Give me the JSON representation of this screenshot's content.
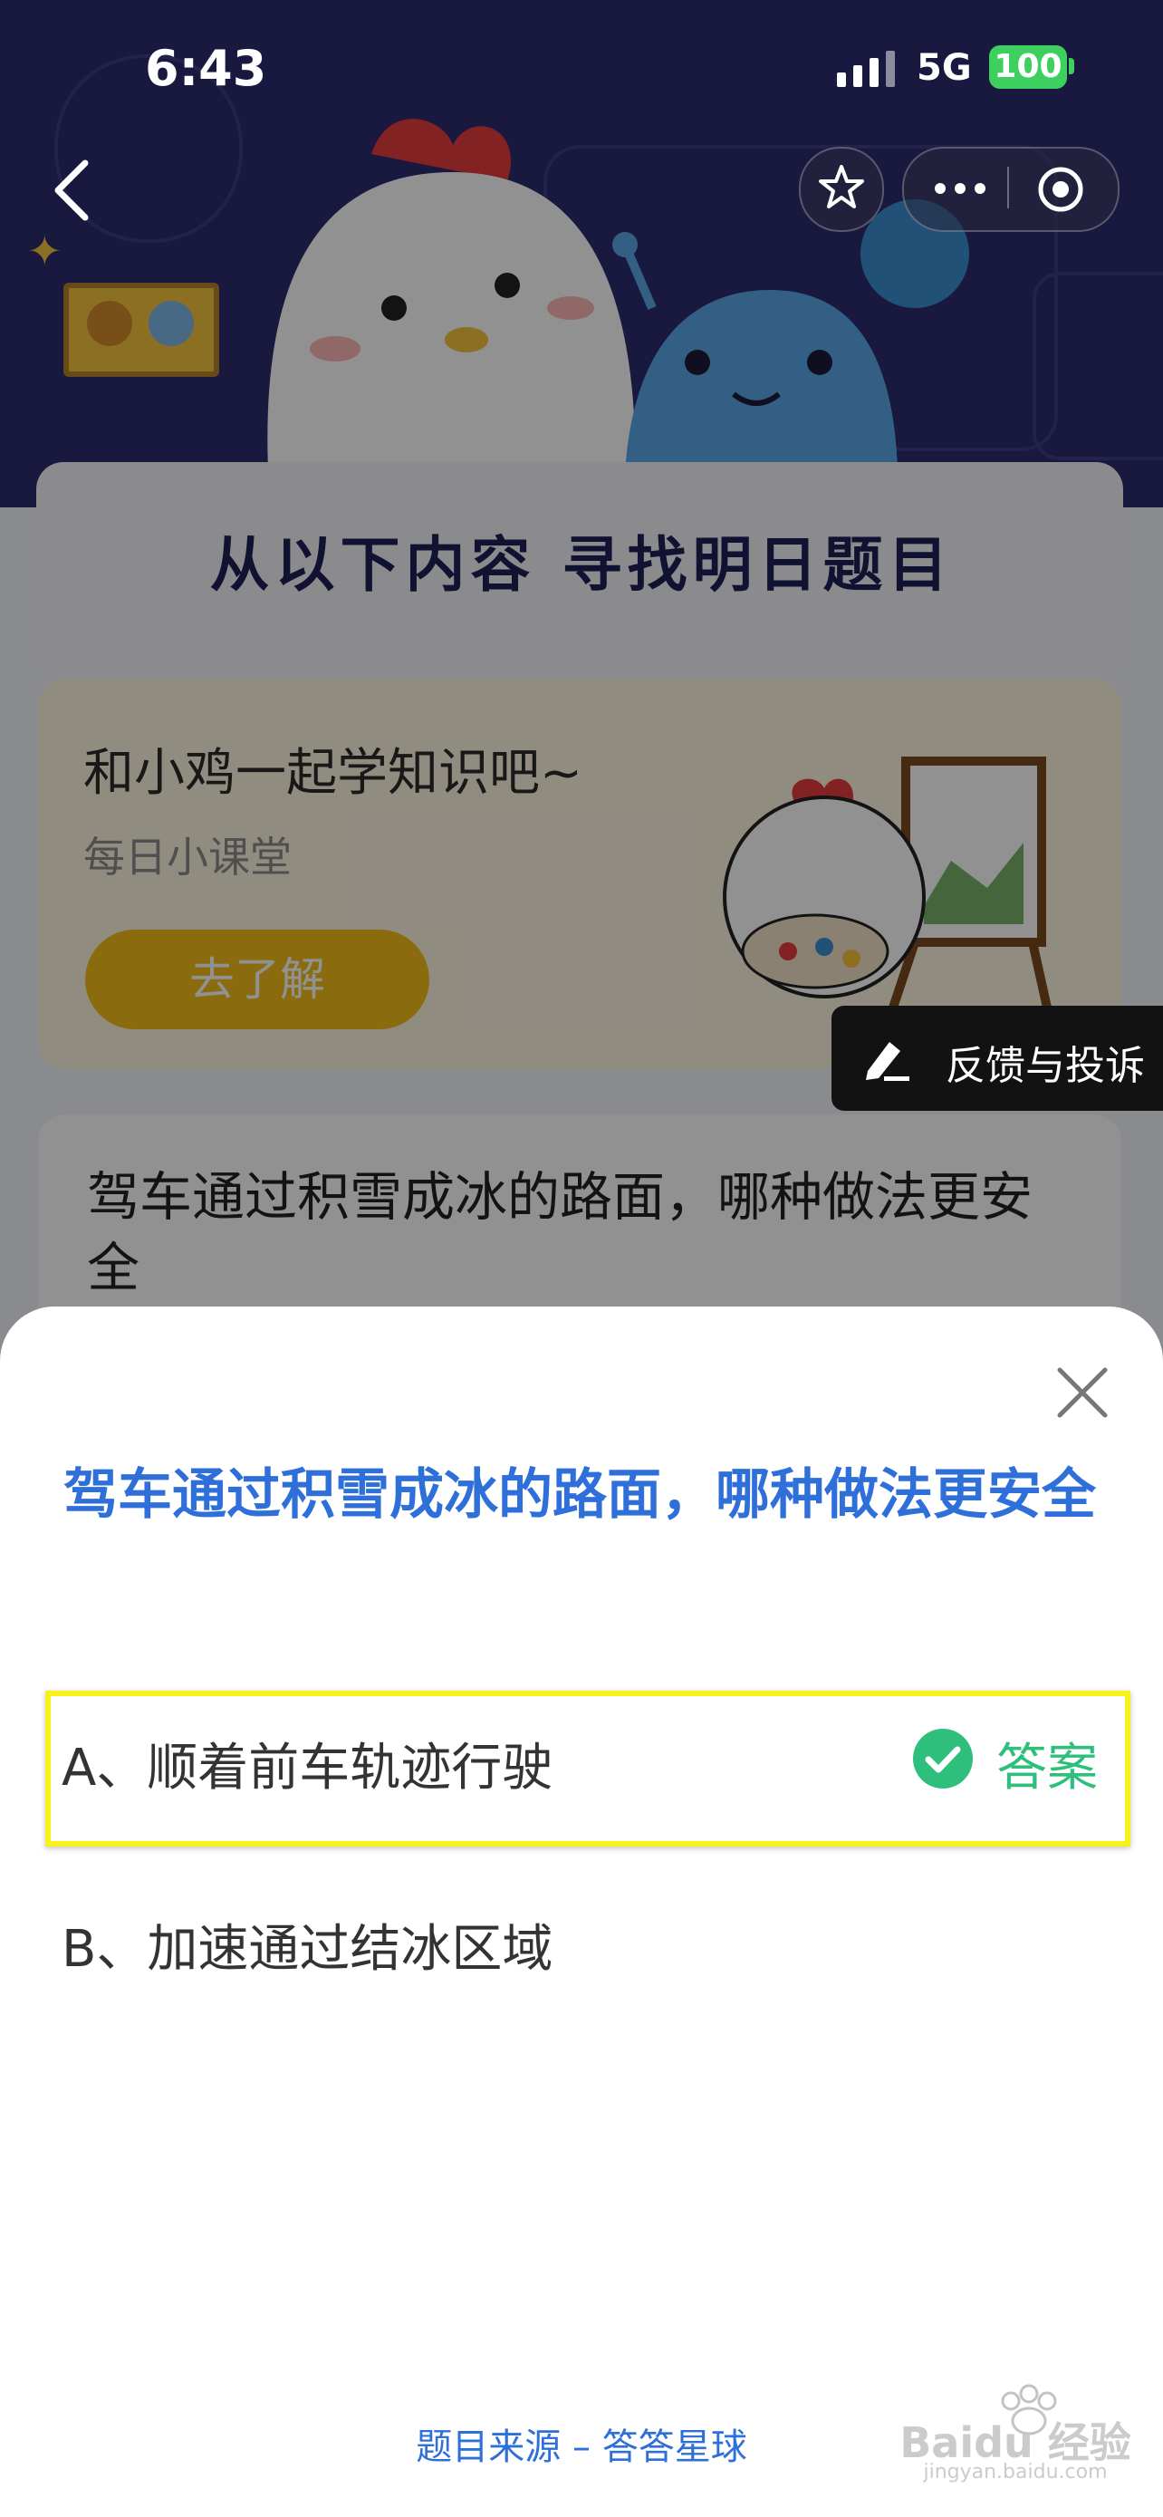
{
  "status_bar": {
    "time": "6:43",
    "network": "5G",
    "battery": "100"
  },
  "page": {
    "headline": "从以下内容 寻找明日题目",
    "promo": {
      "title": "和小鸡一起学知识吧~",
      "subtitle": "每日小课堂",
      "button": "去了解"
    },
    "question_card": {
      "title": "驾车通过积雪成冰的路面，哪种做法更安全"
    },
    "feedback": "反馈与投诉"
  },
  "sheet": {
    "question": "驾车通过积雪成冰的路面，哪种做法更安全",
    "options": [
      {
        "label": "A、顺着前车轨迹行驶",
        "tag": "答案"
      },
      {
        "label": "B、加速通过结冰区域"
      }
    ],
    "source": "题目来源 – 答答星球",
    "watermark_text": "Baidu 经验",
    "watermark_url": "jingyan.baidu.com"
  },
  "colors": {
    "accent_blue": "#2e6fd9",
    "answer_green": "#2fbf7d",
    "highlight_yellow": "#f8f21b",
    "promo_button": "#f3bd19"
  }
}
